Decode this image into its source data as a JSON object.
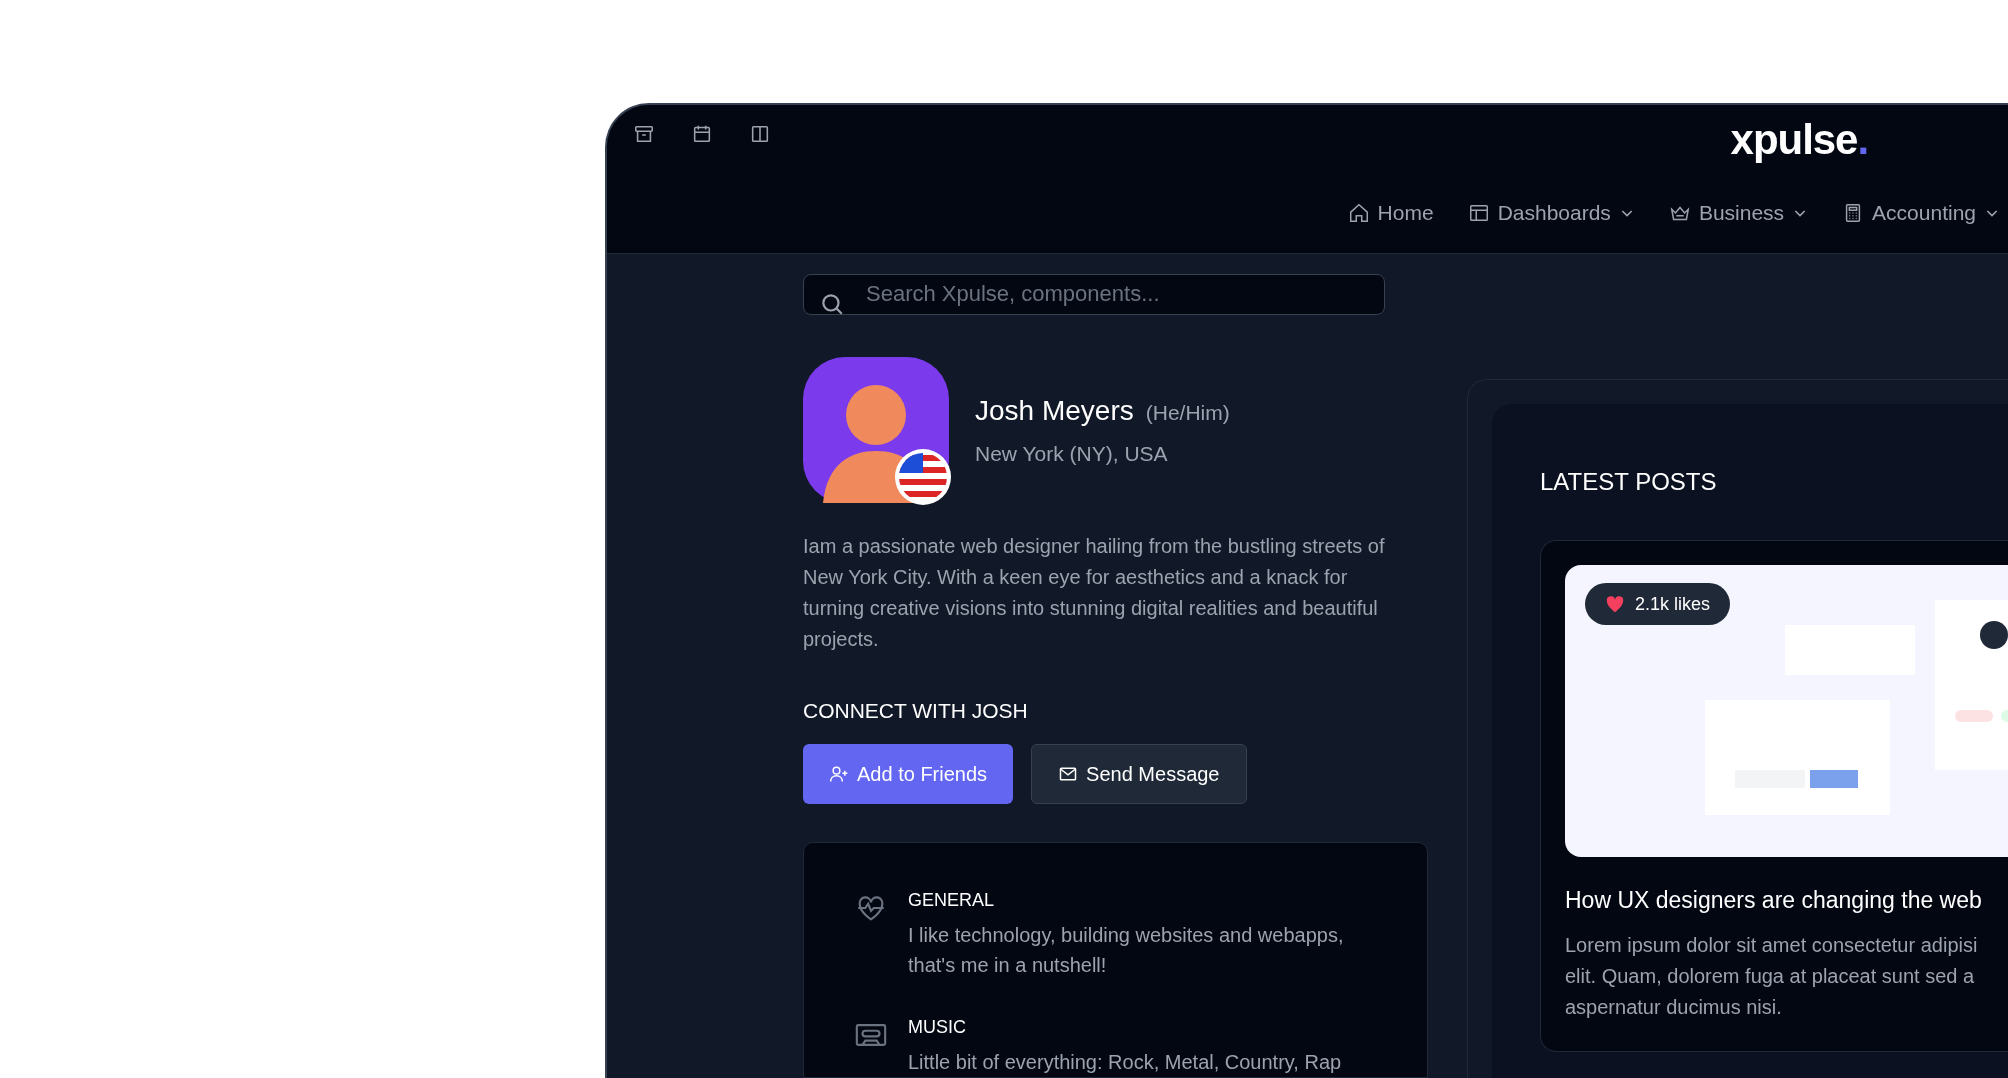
{
  "logo": "xpulse.",
  "nav": [
    {
      "label": "Home",
      "kind": "home",
      "dropdown": false
    },
    {
      "label": "Dashboards",
      "kind": "layout",
      "dropdown": true
    },
    {
      "label": "Business",
      "kind": "crown",
      "dropdown": true
    },
    {
      "label": "Accounting",
      "kind": "calculator",
      "dropdown": true
    }
  ],
  "search": {
    "placeholder": "Search Xpulse, components..."
  },
  "profile": {
    "name": "Josh Meyers",
    "pronouns": "(He/Him)",
    "location": "New York (NY), USA",
    "bio": "Iam a passionate web designer hailing from the bustling streets of New York City. With a keen eye for aesthetics and a knack for turning creative visions into stunning digital realities and beautiful projects."
  },
  "connect": {
    "heading": "CONNECT WITH JOSH",
    "buttons": [
      {
        "label": "Add to Friends",
        "kind": "primary"
      },
      {
        "label": "Send Message",
        "kind": "secondary"
      }
    ]
  },
  "interests": [
    {
      "kind": "heart",
      "title": "GENERAL",
      "text": "I like technology, building websites and webapps, that's me in a nutshell!"
    },
    {
      "kind": "cassette",
      "title": "MUSIC",
      "text": "Little bit of everything: Rock, Metal, Country, Rap"
    }
  ],
  "latest_posts": {
    "heading": "LATEST POSTS",
    "posts": [
      {
        "likes": "2.1k likes",
        "title": "How UX designers are changing the web",
        "excerpt": "Lorem ipsum dolor sit amet consectetur adipisi elit. Quam, dolorem fuga at placeat sunt sed a aspernatur ducimus nisi."
      }
    ]
  }
}
